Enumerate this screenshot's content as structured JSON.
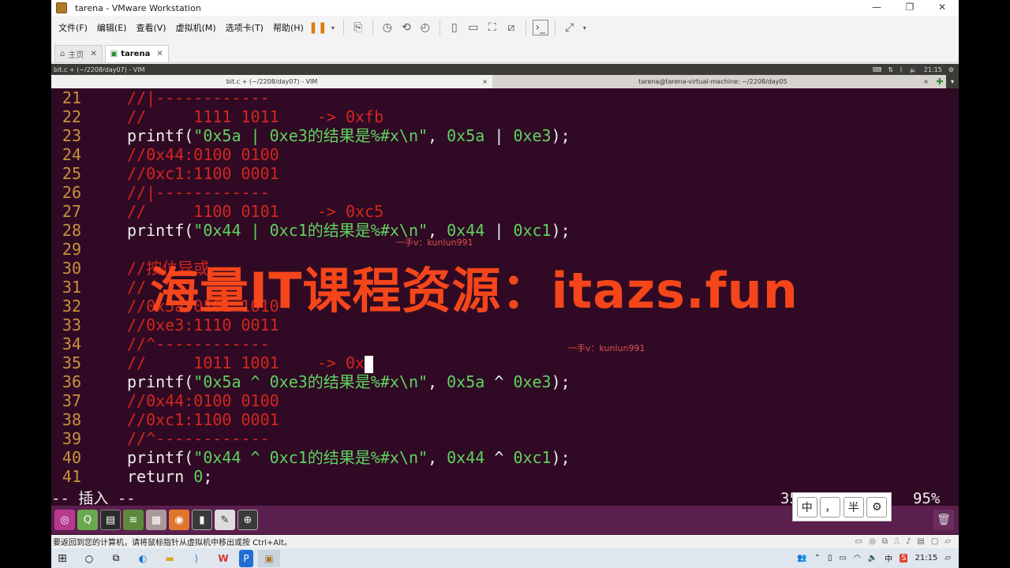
{
  "vmware": {
    "title": "tarena - VMware Workstation",
    "menu": [
      "文件(F)",
      "编辑(E)",
      "查看(V)",
      "虚拟机(M)",
      "选项卡(T)",
      "帮助(H)"
    ],
    "tabs": [
      {
        "label": "主页"
      },
      {
        "label": "tarena"
      }
    ],
    "statusbar": "要返回到您的计算机，请将鼠标指针从虚拟机中移出或按 Ctrl+Alt。"
  },
  "guest": {
    "topbar_title": "bit.c + (~/2208/day07) - VIM",
    "clock": "21:15",
    "term_tabs": [
      {
        "label": "bit.c + (~/2208/day07) - VIM"
      },
      {
        "label": "tarena@tarena-virtual-machine: ~/2208/day05"
      }
    ]
  },
  "editor": {
    "lines": [
      {
        "n": "21",
        "type": "comment",
        "text": "//|------------"
      },
      {
        "n": "22",
        "type": "comment",
        "text": "//     1111 1011    -> 0xfb"
      },
      {
        "n": "23",
        "type": "code",
        "pre": "printf(",
        "str": "\"0x5a | 0xe3的结果是%#x\\n\"",
        "post": ", ",
        "a": "0x5a",
        "op": " | ",
        "b": "0xe3",
        "end": ");"
      },
      {
        "n": "24",
        "type": "comment",
        "text": "//0x44:0100 0100"
      },
      {
        "n": "25",
        "type": "comment",
        "text": "//0xc1:1100 0001"
      },
      {
        "n": "26",
        "type": "comment",
        "text": "//|------------"
      },
      {
        "n": "27",
        "type": "comment",
        "text": "//     1100 0101    -> 0xc5"
      },
      {
        "n": "28",
        "type": "code",
        "pre": "printf(",
        "str": "\"0x44 | 0xc1的结果是%#x\\n\"",
        "post": ", ",
        "a": "0x44",
        "op": " | ",
        "b": "0xc1",
        "end": ");"
      },
      {
        "n": "29",
        "type": "comment",
        "text": ""
      },
      {
        "n": "30",
        "type": "comment",
        "text": "//按位异或"
      },
      {
        "n": "31",
        "type": "comment",
        "text": "//"
      },
      {
        "n": "32",
        "type": "comment",
        "text": "//0x5a:0101 1010"
      },
      {
        "n": "33",
        "type": "comment",
        "text": "//0xe3:1110 0011"
      },
      {
        "n": "34",
        "type": "comment",
        "text": "//^------------"
      },
      {
        "n": "35",
        "type": "cursor",
        "text": "//     1011 1001    -> 0x"
      },
      {
        "n": "36",
        "type": "code",
        "pre": "printf(",
        "str": "\"0x5a ^ 0xe3的结果是%#x\\n\"",
        "post": ", ",
        "a": "0x5a",
        "op": " ^ ",
        "b": "0xe3",
        "end": ");"
      },
      {
        "n": "37",
        "type": "comment",
        "text": "//0x44:0100 0100"
      },
      {
        "n": "38",
        "type": "comment",
        "text": "//0xc1:1100 0001"
      },
      {
        "n": "39",
        "type": "comment",
        "text": "//^------------"
      },
      {
        "n": "40",
        "type": "code",
        "pre": "printf(",
        "str": "\"0x44 ^ 0xc1的结果是%#x\\n\"",
        "post": ", ",
        "a": "0x44",
        "op": " ^ ",
        "b": "0xc1",
        "end": ");"
      },
      {
        "n": "41",
        "type": "ret",
        "text": "return ",
        "num": "0",
        "end": ";"
      }
    ],
    "mode": "-- 插入 --",
    "position": "35,30",
    "percent": "95%"
  },
  "ime": [
    "中",
    "，",
    "半",
    "⚙"
  ],
  "watermark": {
    "big": "海量IT课程资源：itazs.fun",
    "small1": "一手v：kunlun991",
    "small2": "一手v：kunlun991"
  },
  "taskbar": {
    "lang": "中",
    "time": "21:15"
  },
  "colors": {
    "terminal_bg": "#300a24",
    "comment": "#d1271e",
    "string": "#5fd35f",
    "line_number": "#c8923c",
    "launcher": "#5b1f4e"
  }
}
